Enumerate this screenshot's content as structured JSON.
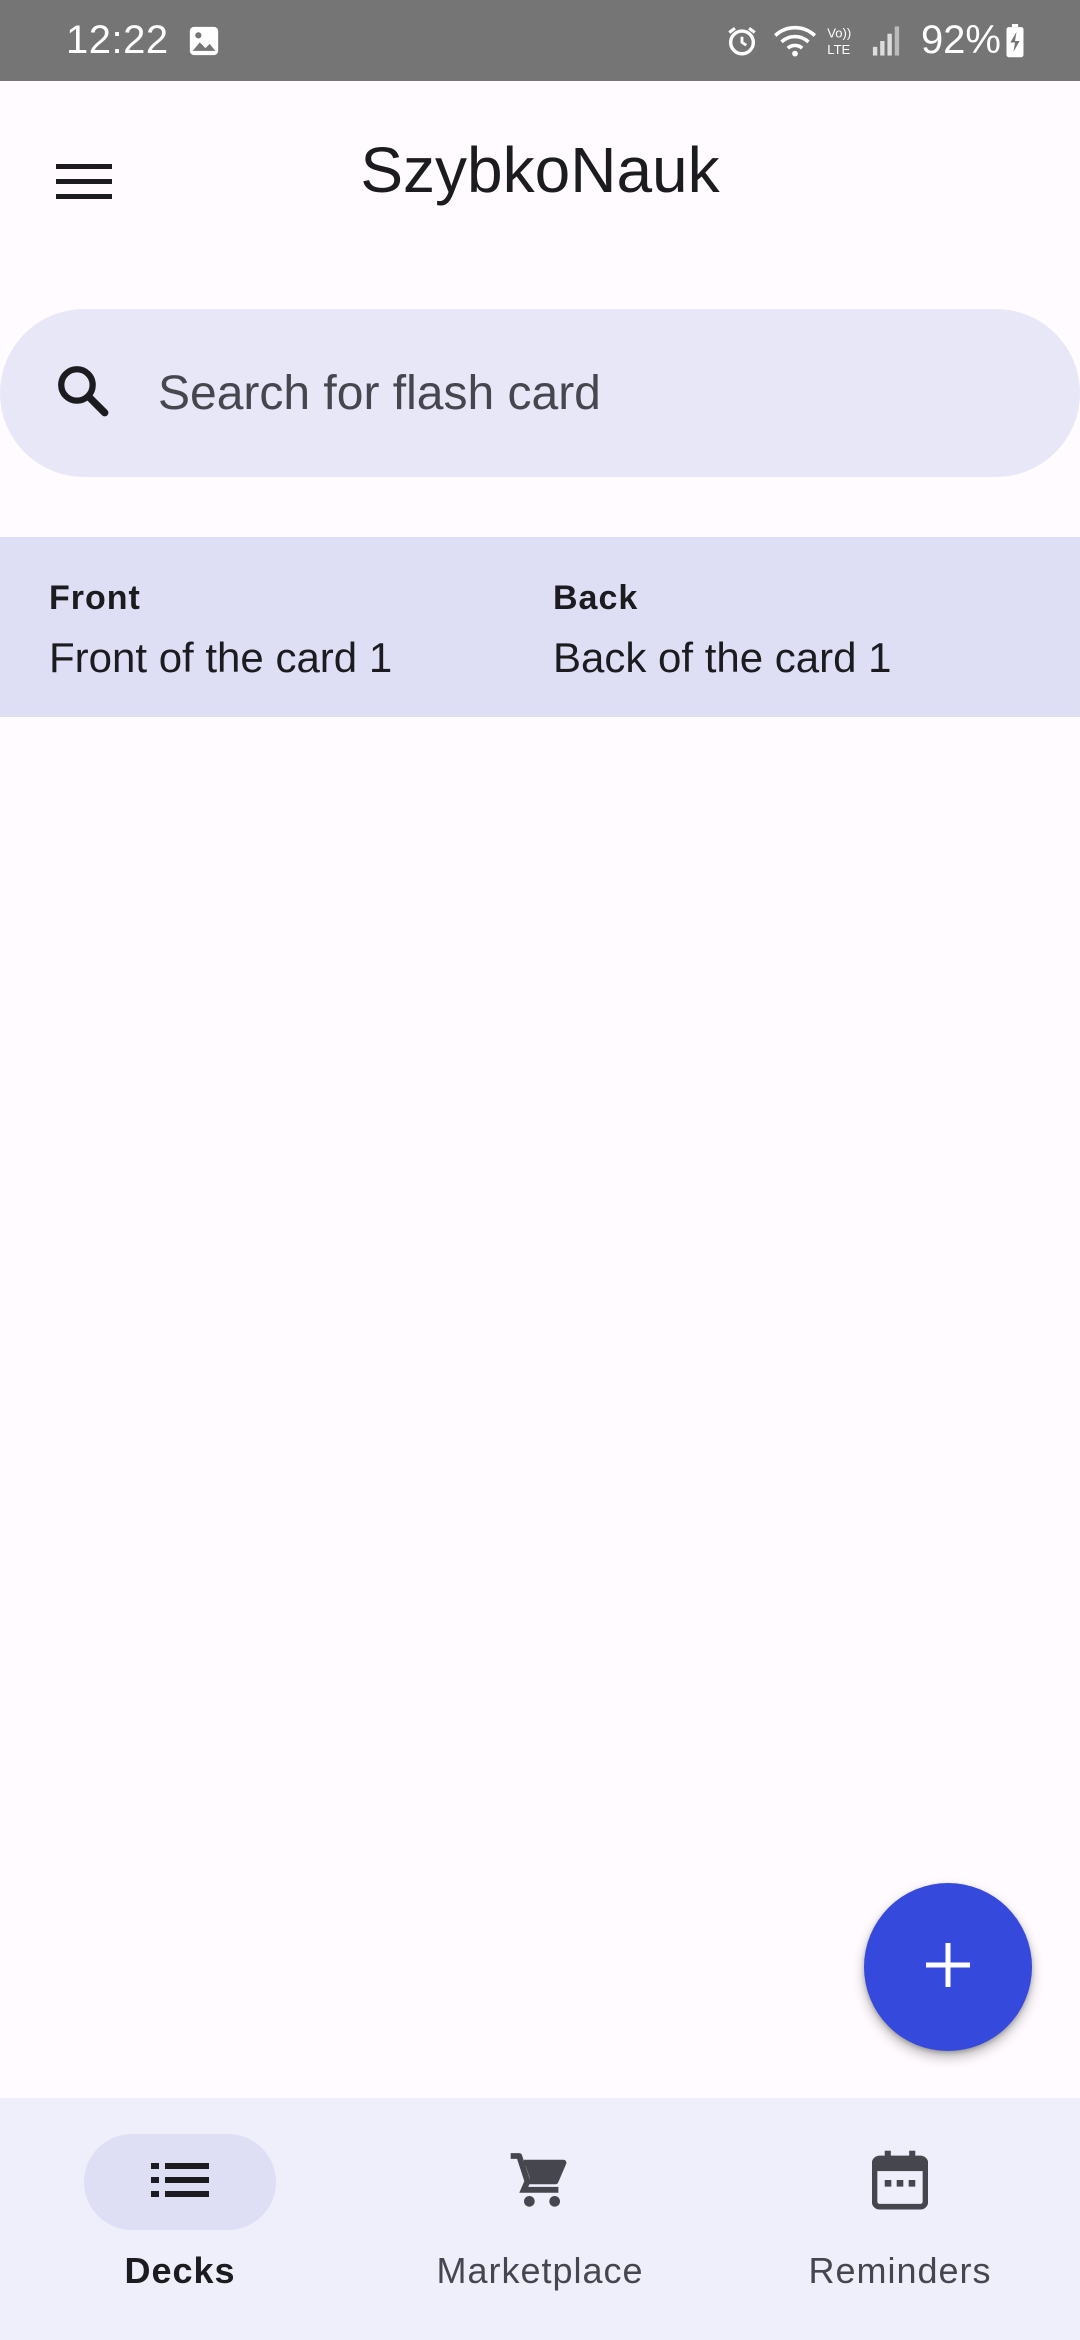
{
  "status_bar": {
    "time": "12:22",
    "battery": "92%",
    "icons": [
      "image-icon",
      "alarm-icon",
      "wifi-icon",
      "volte-icon",
      "signal-icon",
      "battery-charging-icon"
    ]
  },
  "app_bar": {
    "title": "SzybkoNauk",
    "menu_icon": "menu-icon"
  },
  "search": {
    "placeholder": "Search for flash card",
    "value": ""
  },
  "cards": [
    {
      "front_label": "Front",
      "front_value": "Front of the card 1",
      "back_label": "Back",
      "back_value": "Back of the card 1"
    }
  ],
  "fab": {
    "icon": "add-icon",
    "color": "#3549dd"
  },
  "bottom_nav": {
    "items": [
      {
        "label": "Decks",
        "icon": "list-icon",
        "active": true
      },
      {
        "label": "Marketplace",
        "icon": "cart-icon",
        "active": false
      },
      {
        "label": "Reminders",
        "icon": "calendar-icon",
        "active": false
      }
    ]
  },
  "colors": {
    "status_bar": "#757575",
    "background": "#fffbfe",
    "search_bg": "#e8e7f8",
    "card_bg": "#dedff5",
    "nav_bg": "#efeffb",
    "accent": "#3549dd"
  }
}
